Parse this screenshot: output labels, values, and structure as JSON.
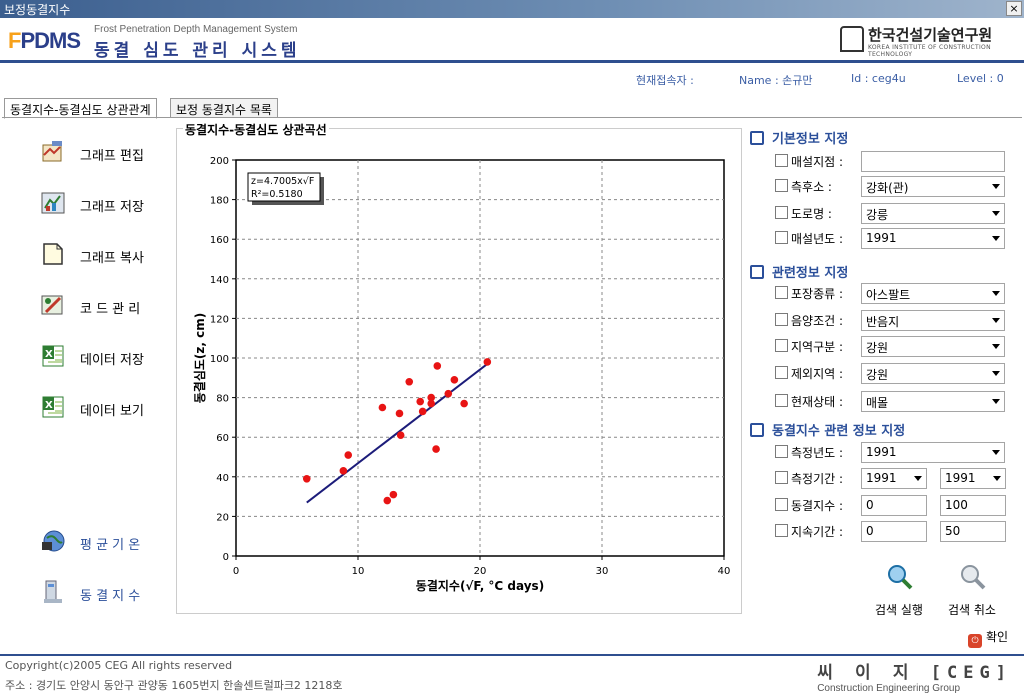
{
  "window": {
    "title": "보정동결지수",
    "close": "×"
  },
  "header": {
    "logo_short": "FPDMS",
    "logo_short_first": "F",
    "logo_short_rest": "PDMS",
    "logo_en": "Frost Penetration Depth Management System",
    "logo_kr": "동결 심도 관리 시스템",
    "org_name": "한국건설기술연구원",
    "org_en": "KOREA INSTITUTE OF CONSTRUCTION TECHNOLOGY",
    "org_mark": "KICT"
  },
  "user": {
    "label": "현재접속자 :",
    "name": "Name : 손규만",
    "id": "Id : ceg4u",
    "level": "Level :   0"
  },
  "tabs": [
    {
      "label": "동결지수-동결심도 상관관계",
      "active": true
    },
    {
      "label": "보정 동결지수 목록",
      "active": false
    }
  ],
  "sidebar": {
    "items": [
      {
        "label": "그래프 편집",
        "icon": "graph-edit-icon"
      },
      {
        "label": "그래프 저장",
        "icon": "graph-save-icon"
      },
      {
        "label": "그래프 복사",
        "icon": "graph-copy-icon"
      },
      {
        "label": "코 드 관 리",
        "icon": "code-manage-icon"
      },
      {
        "label": "데이터 저장",
        "icon": "excel-icon"
      },
      {
        "label": "데이터 보기",
        "icon": "excel-icon"
      }
    ],
    "bottom_items": [
      {
        "label": "평 균 기 온",
        "icon": "globe-icon"
      },
      {
        "label": "동 결 지 수",
        "icon": "computer-icon"
      }
    ]
  },
  "chart_data": {
    "type": "scatter",
    "title": "동결지수-동결심도 상관곡선",
    "xlabel": "동결지수(√F, °C days)",
    "ylabel": "동결심도(z, cm)",
    "xlim": [
      0,
      40
    ],
    "ylim": [
      0,
      200
    ],
    "xticks": [
      0,
      10,
      20,
      30,
      40
    ],
    "yticks": [
      0,
      20,
      40,
      60,
      80,
      100,
      120,
      140,
      160,
      180,
      200
    ],
    "grid": "dashed",
    "annotation": [
      "z=4.7005x√F",
      "R²=0.5180"
    ],
    "points": [
      {
        "x": 5.8,
        "y": 39
      },
      {
        "x": 8.8,
        "y": 43
      },
      {
        "x": 9.2,
        "y": 51
      },
      {
        "x": 12.0,
        "y": 75
      },
      {
        "x": 12.4,
        "y": 28
      },
      {
        "x": 12.9,
        "y": 31
      },
      {
        "x": 13.4,
        "y": 72
      },
      {
        "x": 13.5,
        "y": 61
      },
      {
        "x": 14.2,
        "y": 88
      },
      {
        "x": 15.1,
        "y": 78
      },
      {
        "x": 15.3,
        "y": 73
      },
      {
        "x": 16.0,
        "y": 77
      },
      {
        "x": 16.0,
        "y": 80
      },
      {
        "x": 16.4,
        "y": 54
      },
      {
        "x": 16.5,
        "y": 96
      },
      {
        "x": 17.4,
        "y": 82
      },
      {
        "x": 17.9,
        "y": 89
      },
      {
        "x": 18.7,
        "y": 77
      },
      {
        "x": 20.6,
        "y": 98
      }
    ],
    "fit_line": {
      "x": [
        5.8,
        20.6
      ],
      "y": [
        27,
        97
      ]
    },
    "point_color": "#e81414",
    "line_color": "#1c1c7a"
  },
  "filters": {
    "basic": {
      "title": "기본정보 지정",
      "rows": [
        {
          "label": "매설지점 :",
          "value": ""
        },
        {
          "label": "측후소 :",
          "value": "강화(관)"
        },
        {
          "label": "도로명 :",
          "value": "강릉"
        },
        {
          "label": "매설년도 :",
          "value": "1991"
        }
      ]
    },
    "related": {
      "title": "관련정보 지정",
      "rows": [
        {
          "label": "포장종류 :",
          "value": "아스팔트"
        },
        {
          "label": "음양조건 :",
          "value": "반음지"
        },
        {
          "label": "지역구분 :",
          "value": "강원"
        },
        {
          "label": "제외지역 :",
          "value": "강원"
        },
        {
          "label": "현재상태 :",
          "value": "매몰"
        }
      ]
    },
    "freeze": {
      "title": "동결지수 관련 정보 지정",
      "rows": [
        {
          "label": "측정년도 :",
          "value": "1991"
        },
        {
          "label": "측정기간 :",
          "from": "1991",
          "to": "1991"
        },
        {
          "label": "동결지수 :",
          "from": "0",
          "to": "100"
        },
        {
          "label": "지속기간 :",
          "from": "0",
          "to": "50"
        }
      ]
    }
  },
  "actions": {
    "search": "검색 실행",
    "cancel": "검색 취소",
    "ok": "확인"
  },
  "footer": {
    "copyright": "Copyright(c)2005 CEG All rights reserved",
    "address": "주소 : 경기도 안양시 동안구 관양동 1605번지 한솔센트럴파크2 1218호",
    "company_kr": "씨 이 지 [CEG]",
    "company_en": "Construction  Engineering Group"
  }
}
